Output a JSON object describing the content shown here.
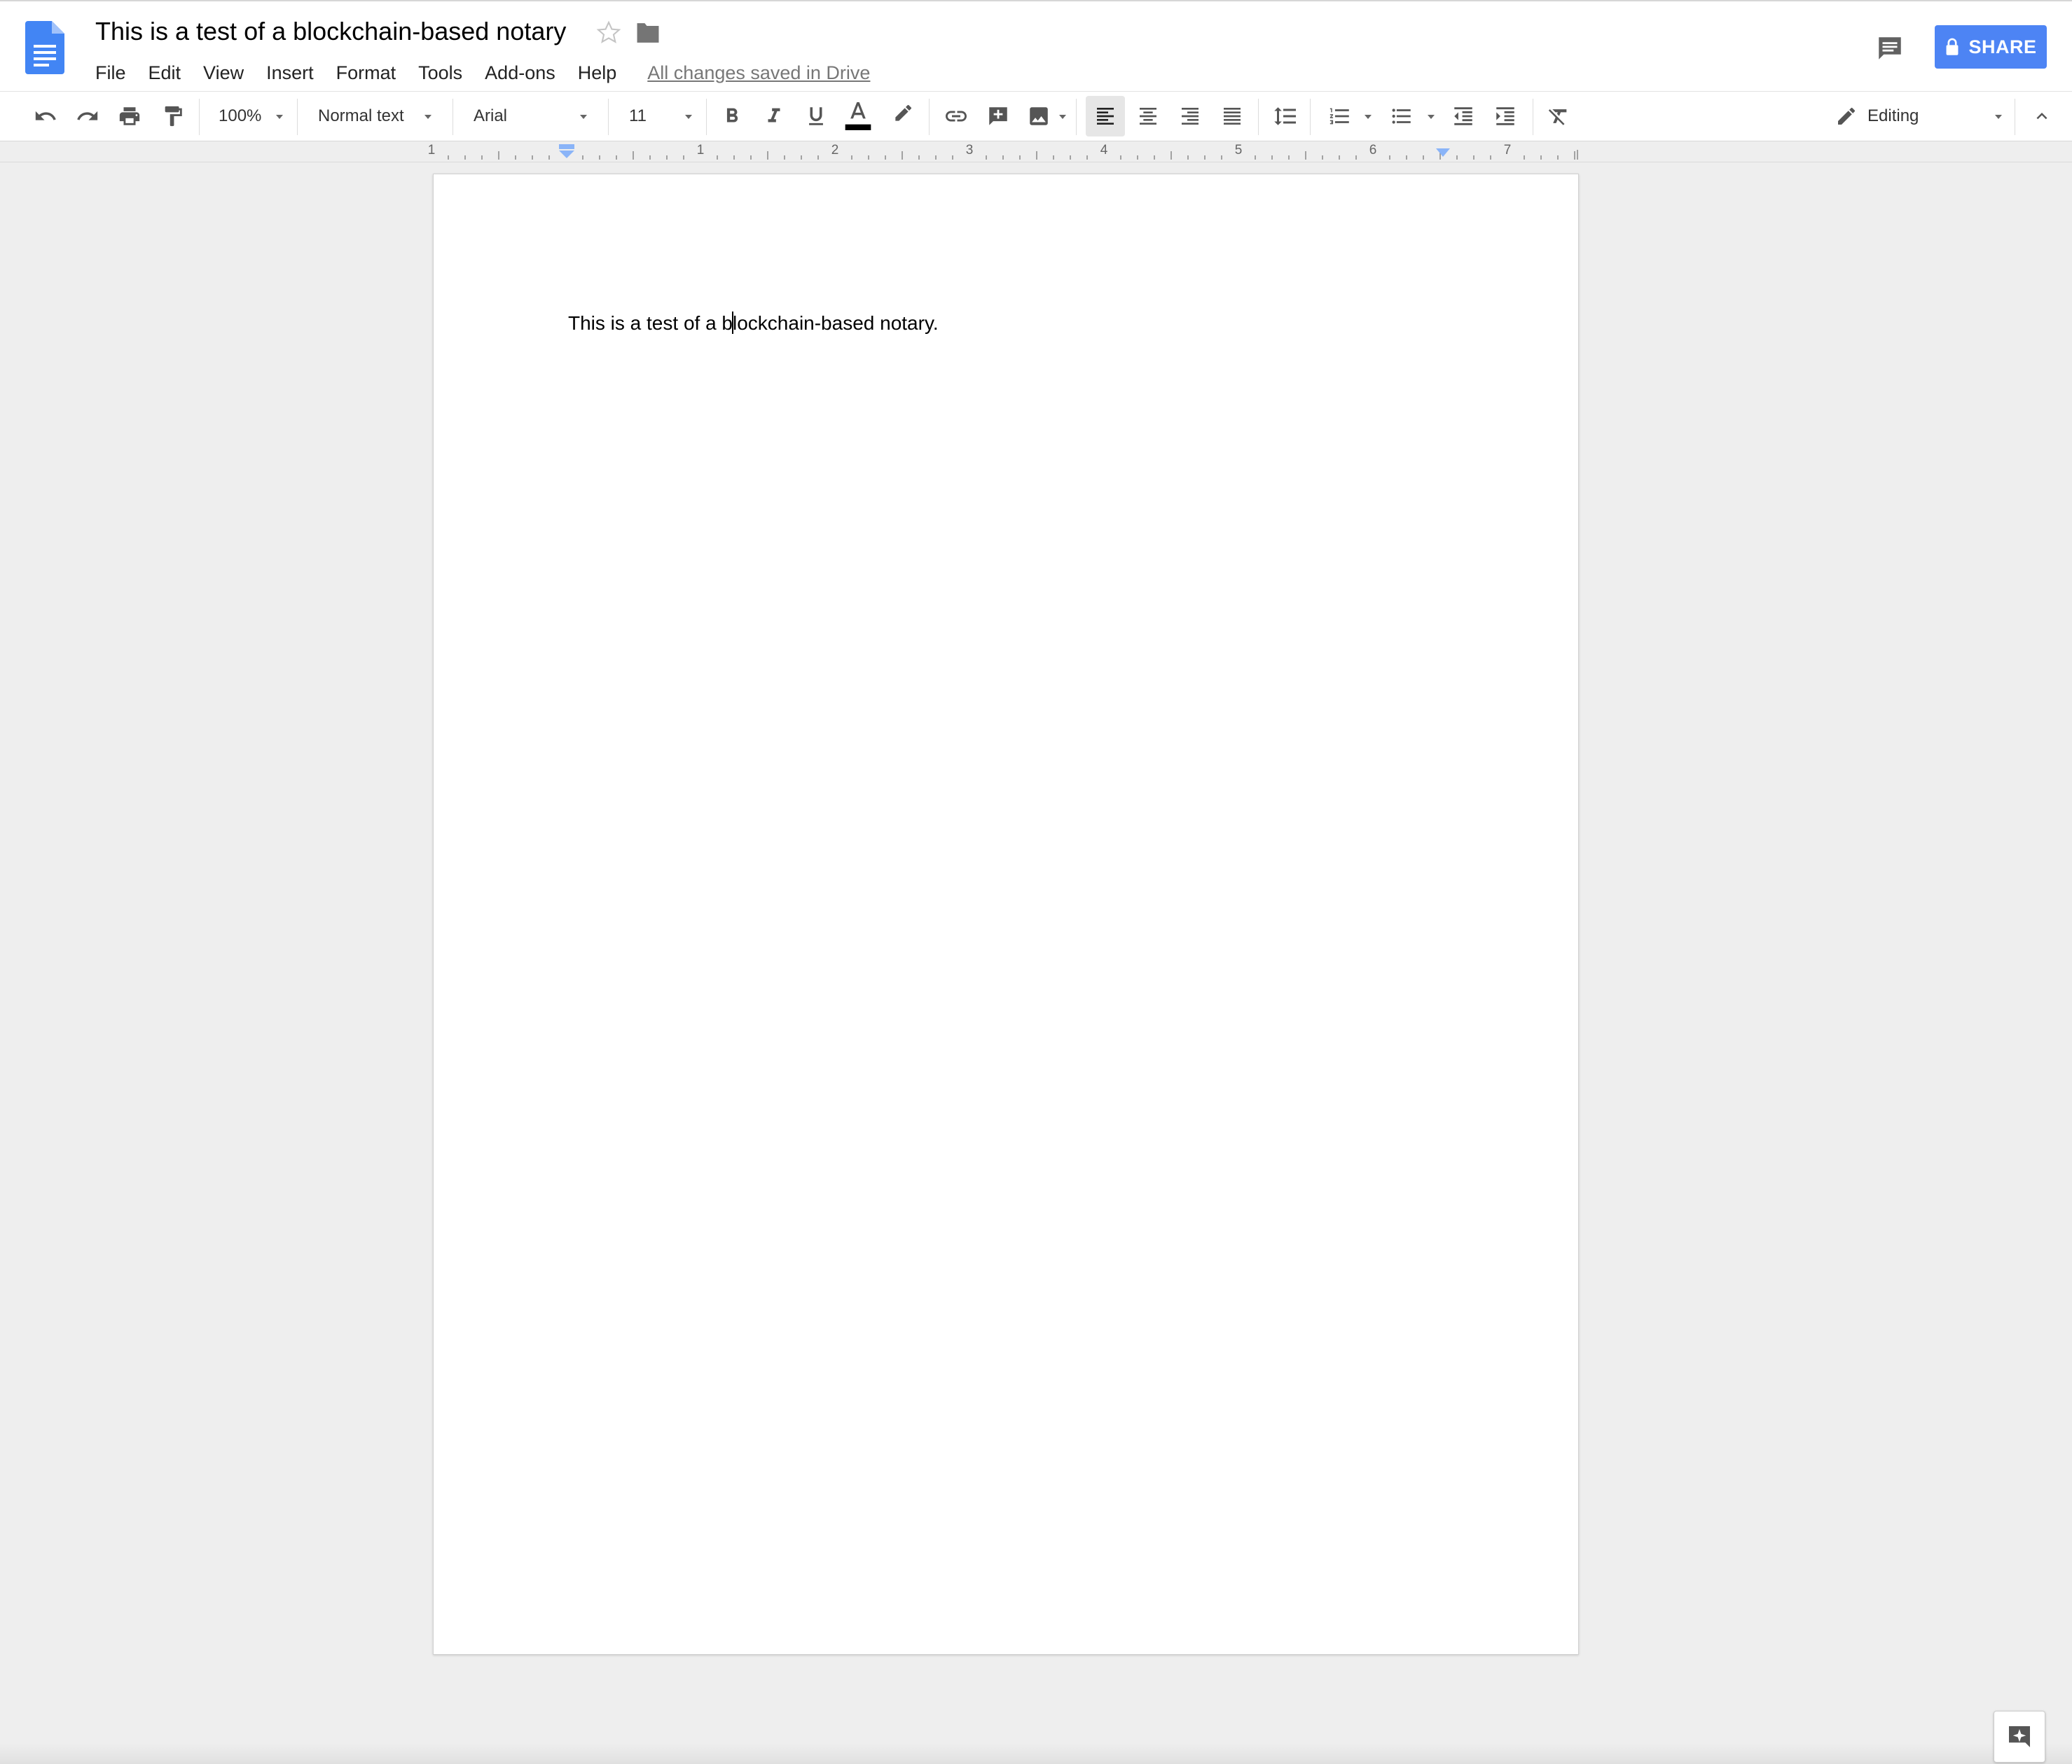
{
  "document": {
    "title": "This is a test of a blockchain-based notary",
    "saved_status": "All changes saved in Drive",
    "body_before_cursor": "This is a test of a b",
    "body_after_cursor": "lockchain-based notary."
  },
  "menu": [
    "File",
    "Edit",
    "View",
    "Insert",
    "Format",
    "Tools",
    "Add-ons",
    "Help"
  ],
  "share_label": "SHARE",
  "toolbar": {
    "zoom": "100%",
    "style": "Normal text",
    "font": "Arial",
    "font_size": "11",
    "mode": "Editing"
  },
  "ruler_numbers": [
    "1",
    "1",
    "2",
    "3",
    "4",
    "5",
    "6",
    "7"
  ],
  "colors": {
    "share_blue": "#4d84f4",
    "docs_blue": "#4285f4",
    "text_color_bar": "#000000"
  },
  "icons": [
    "docs-logo-icon",
    "star-icon",
    "folder-icon",
    "comment-icon",
    "lock-icon",
    "undo-icon",
    "redo-icon",
    "print-icon",
    "paint-format-icon",
    "bold-icon",
    "italic-icon",
    "underline-icon",
    "text-color-icon",
    "highlight-icon",
    "link-icon",
    "add-comment-icon",
    "image-icon",
    "align-left-icon",
    "align-center-icon",
    "align-right-icon",
    "align-justify-icon",
    "line-spacing-icon",
    "numbered-list-icon",
    "bulleted-list-icon",
    "decrease-indent-icon",
    "increase-indent-icon",
    "clear-formatting-icon",
    "pencil-icon",
    "collapse-icon",
    "explore-icon"
  ]
}
